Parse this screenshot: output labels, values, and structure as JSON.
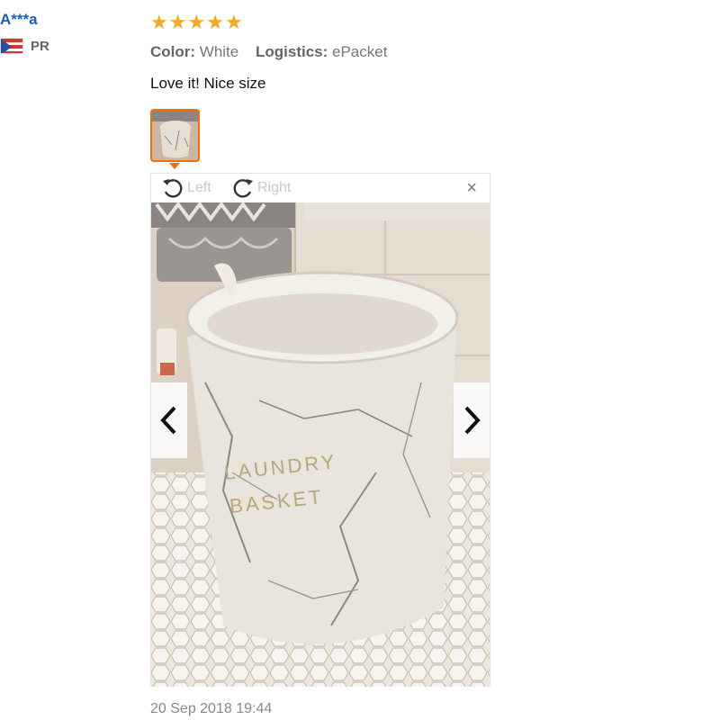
{
  "reviewer": {
    "name": "A***a",
    "country_code": "PR",
    "flag_icon": "puerto-rico-flag-icon"
  },
  "review": {
    "rating": 5,
    "rating_max": 5,
    "star_color": "#f5a623",
    "color_label": "Color:",
    "color_value": "White",
    "logistics_label": "Logistics:",
    "logistics_value": "ePacket",
    "text": "Love it! Nice size",
    "date": "20 Sep 2018 19:44"
  },
  "viewer": {
    "rotate_left_label": "Left",
    "rotate_right_label": "Right",
    "close_label": "×",
    "image_text_line1": "LAUNDRY",
    "image_text_line2": "BASKET",
    "icons": [
      "rotate-left-icon",
      "rotate-right-icon",
      "close-icon",
      "chevron-left-icon",
      "chevron-right-icon"
    ]
  },
  "colors": {
    "accent": "#ff6a00",
    "name_blue": "#1a5fb4"
  }
}
